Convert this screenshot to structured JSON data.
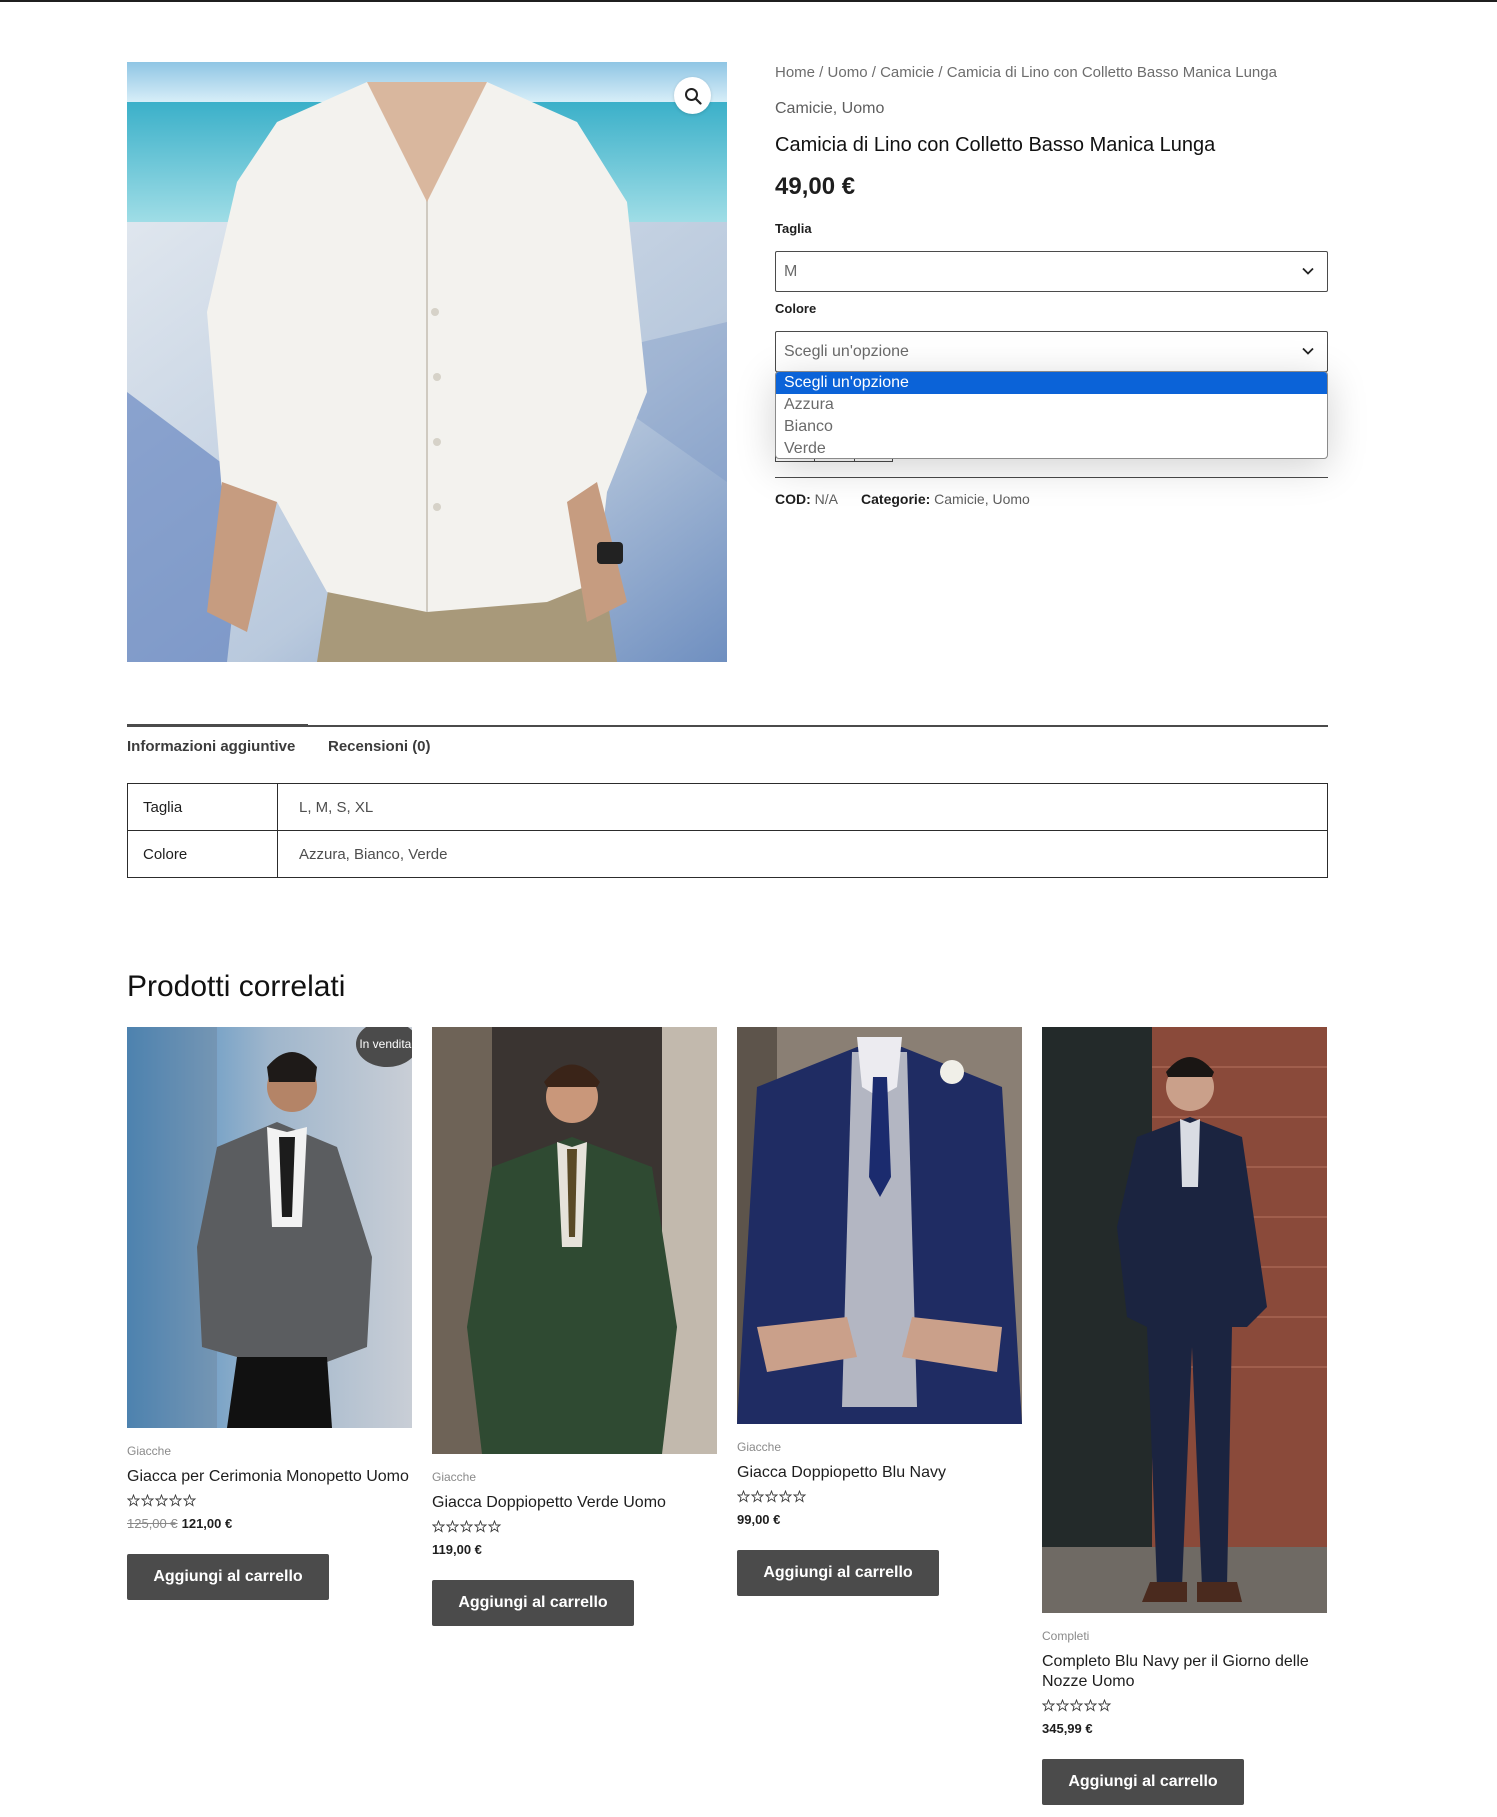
{
  "breadcrumb": {
    "items": [
      "Home",
      "Uomo",
      "Camicie"
    ],
    "current": "Camicia di Lino con Colletto Basso Manica Lunga",
    "separator": " / "
  },
  "product": {
    "categories_line": "Camicie, Uomo",
    "title": "Camicia di Lino con Colletto Basso Manica Lunga",
    "price": "49,00 €",
    "size_label": "Taglia",
    "size_value": "M",
    "color_label": "Colore",
    "color_value": "Scegli un'opzione",
    "color_options": [
      "Scegli un'opzione",
      "Azzura",
      "Bianco",
      "Verde"
    ],
    "sku_label": "COD:",
    "sku_value": "N/A",
    "categories_label": "Categorie:",
    "categories_value": "Camicie, Uomo",
    "image_icon": "zoom-magnifier-icon"
  },
  "tabs": {
    "additional_info": "Informazioni aggiuntive",
    "reviews": "Recensioni (0)"
  },
  "attributes": [
    {
      "name": "Taglia",
      "value": "L, M, S, XL"
    },
    {
      "name": "Colore",
      "value": "Azzura, Bianco, Verde"
    }
  ],
  "related": {
    "title": "Prodotti correlati",
    "add_to_cart": "Aggiungi al carrello",
    "products": [
      {
        "category": "Giacche",
        "name": "Giacca per Cerimonia Monopetto Uomo",
        "old_price": "125,00 €",
        "price": "121,00 €",
        "badge": "In vendita!",
        "rating": 0
      },
      {
        "category": "Giacche",
        "name": "Giacca Doppiopetto Verde Uomo",
        "price": "119,00 €",
        "rating": 0
      },
      {
        "category": "Giacche",
        "name": "Giacca Doppiopetto Blu Navy",
        "price": "99,00 €",
        "rating": 0
      },
      {
        "category": "Completi",
        "name": "Completo Blu Navy per il Giorno delle Nozze Uomo",
        "price": "345,99 €",
        "rating": 0
      }
    ]
  },
  "colors": {
    "button": "#4b4b4b",
    "option_highlight": "#0b63d8"
  }
}
